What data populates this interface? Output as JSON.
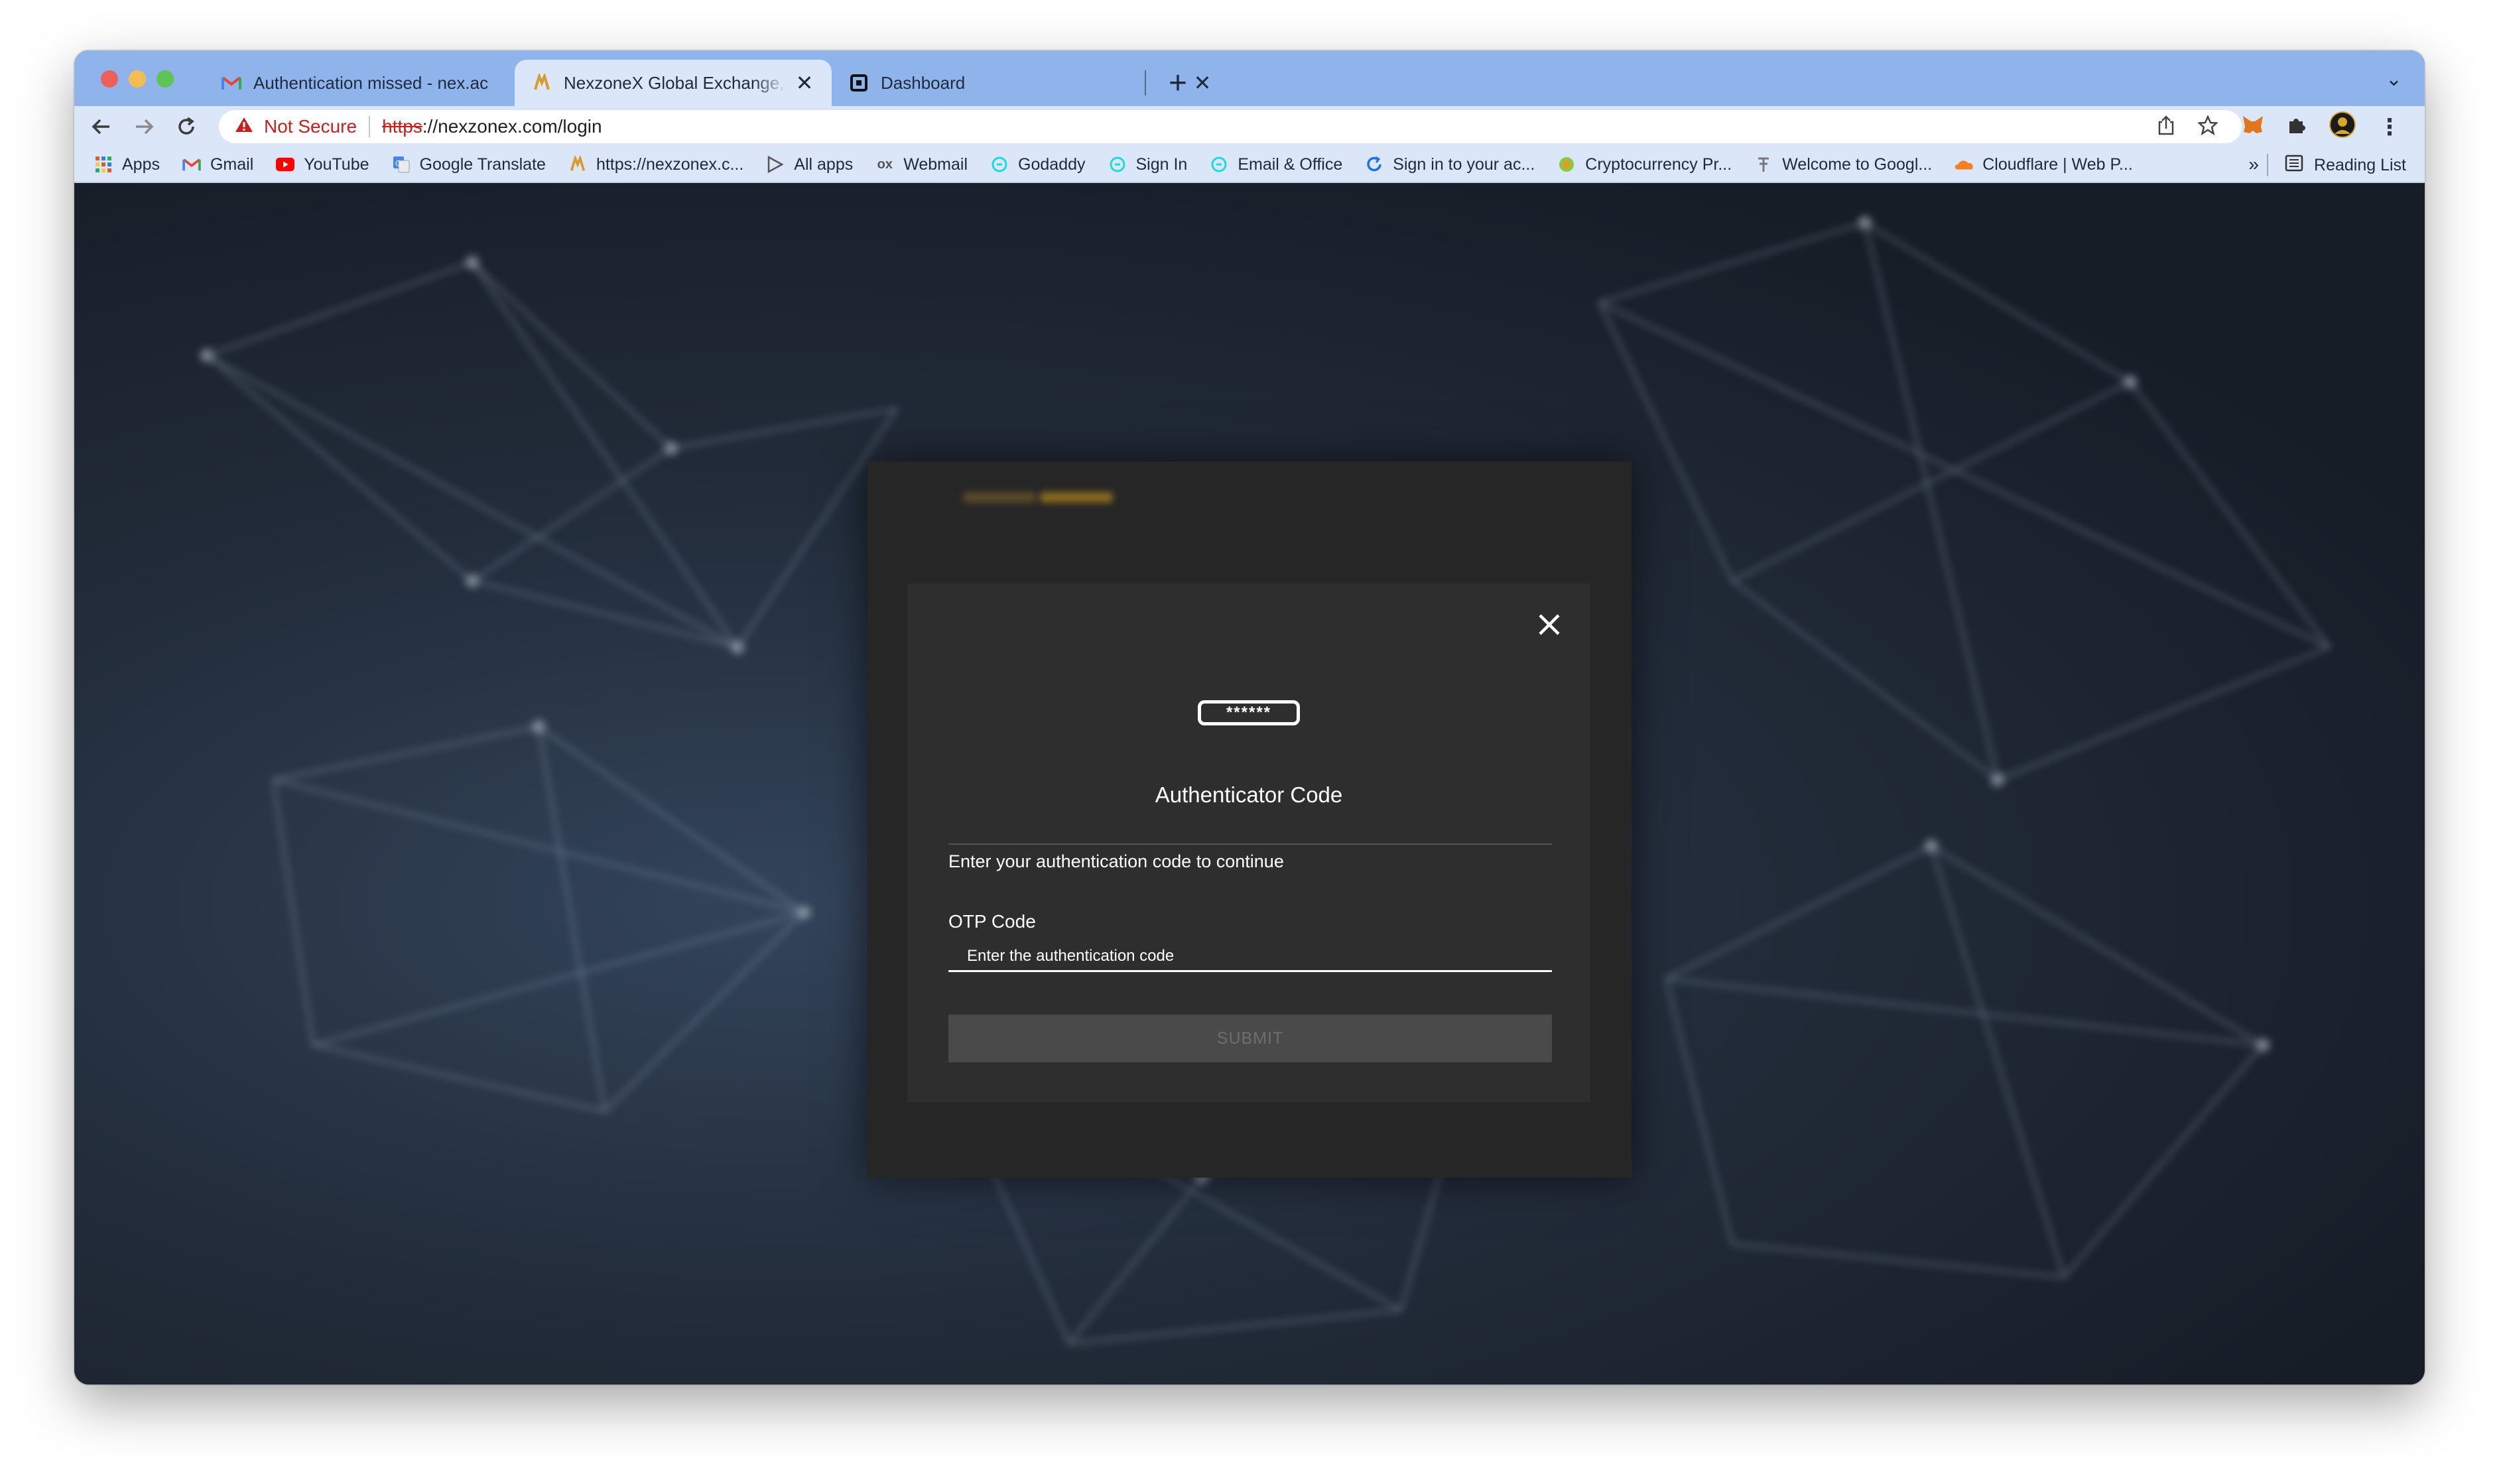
{
  "tabs": [
    {
      "title": "Authentication missed - nex.ac",
      "favicon": "gmail-icon",
      "close": "✕"
    },
    {
      "title": "NexzoneX Global Exchange, Bu",
      "favicon": "nexzonex-icon",
      "close": "✕"
    },
    {
      "title": "Dashboard",
      "favicon": "square-icon",
      "close": "✕"
    }
  ],
  "new_tab": "+",
  "address_bar": {
    "security": "Not Secure",
    "scheme": "https",
    "rest": "://nexzonex.com/login"
  },
  "bookmarks": [
    {
      "label": "Apps",
      "icon": "apps-grid-icon"
    },
    {
      "label": "Gmail",
      "icon": "gmail-icon"
    },
    {
      "label": "YouTube",
      "icon": "youtube-icon"
    },
    {
      "label": "Google Translate",
      "icon": "translate-icon"
    },
    {
      "label": "https://nexzonex.c...",
      "icon": "nexzonex-icon"
    },
    {
      "label": "All apps",
      "icon": "play-icon"
    },
    {
      "label": "Webmail",
      "icon": "webmail-icon"
    },
    {
      "label": "Godaddy",
      "icon": "godaddy-icon"
    },
    {
      "label": "Sign In",
      "icon": "godaddy-icon"
    },
    {
      "label": "Email & Office",
      "icon": "godaddy-icon"
    },
    {
      "label": "Sign in to your ac...",
      "icon": "refresh-blue-icon"
    },
    {
      "label": "Cryptocurrency Pr...",
      "icon": "crypto-icon"
    },
    {
      "label": "Welcome to Googl...",
      "icon": "google-icon"
    },
    {
      "label": "Cloudflare | Web P...",
      "icon": "cloudflare-icon"
    }
  ],
  "bookmarks_more": "»",
  "reading_list": "Reading List",
  "modal": {
    "icon_text": "******",
    "title": "Authenticator Code",
    "subtitle": "Enter your authentication code to continue",
    "otp_label": "OTP Code",
    "otp_placeholder": "Enter the authentication code",
    "otp_value": "",
    "submit_label": "SUBMIT"
  },
  "colors": {
    "tabstrip": "#8fb4ec",
    "toolbar": "#dbe6f8",
    "warning": "#c5221f",
    "modal_bg": "#2e2e2e",
    "submit_bg": "#4a4a4a"
  }
}
